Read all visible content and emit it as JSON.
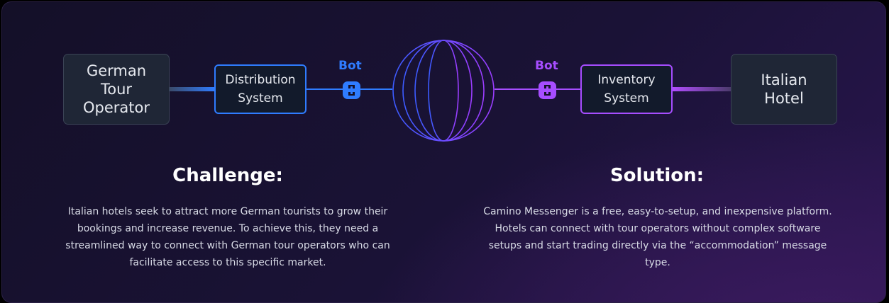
{
  "nodes": {
    "german_operator": "German\nTour\nOperator",
    "distribution_system": "Distribution\nSystem",
    "inventory_system": "Inventory\nSystem",
    "italian_hotel": "Italian\nHotel"
  },
  "bots": {
    "left_label": "Bot",
    "right_label": "Bot"
  },
  "challenge": {
    "title": "Challenge:",
    "text": "Italian hotels seek to attract more German tourists to grow their\nbookings and increase revenue. To achieve this, they need a\nstreamlined way to connect with German tour operators who can\nfacilitate access to this specific market."
  },
  "solution": {
    "title": "Solution:",
    "text": "Camino Messenger is a free, easy-to-setup, and inexpensive platform.\nHotels can connect with tour operators without complex software\nsetups and start trading directly via the “accommodation” message\ntype."
  },
  "colors": {
    "blue": "#2f7cff",
    "purple": "#a64dff",
    "globe_blue": "#3b5bff",
    "globe_purple": "#9b3dff"
  },
  "icons": {
    "bot": "bot-chain-icon",
    "network": "globe-icon"
  }
}
